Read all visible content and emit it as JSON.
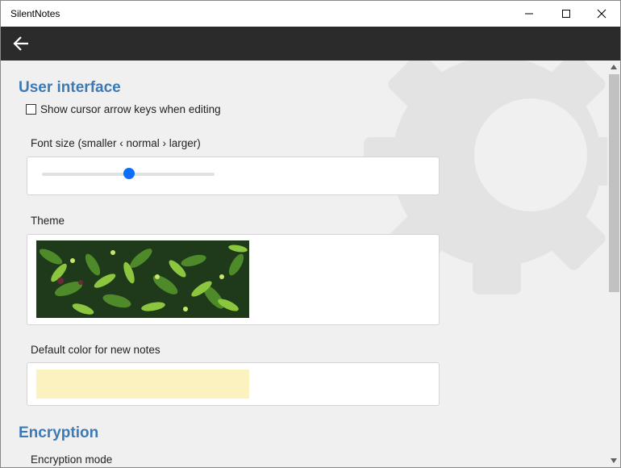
{
  "window": {
    "title": "SilentNotes"
  },
  "toolbar": {
    "back_icon": "arrow-left-icon"
  },
  "ui_section": {
    "title": "User interface",
    "show_cursor_keys": {
      "label": "Show cursor arrow keys when editing",
      "checked": false
    },
    "font_size": {
      "label": "Font size (smaller ‹ normal › larger)",
      "slider_fraction": 0.5
    },
    "theme": {
      "label": "Theme",
      "image": "green-leaves-theme"
    },
    "default_color": {
      "label": "Default color for new notes",
      "color": "#fbf2c0"
    }
  },
  "encryption_section": {
    "title": "Encryption",
    "mode_label": "Encryption mode"
  },
  "colors": {
    "accent": "#3d7ab3",
    "toolbar": "#2b2b2b",
    "slider": "#0d6efd"
  }
}
